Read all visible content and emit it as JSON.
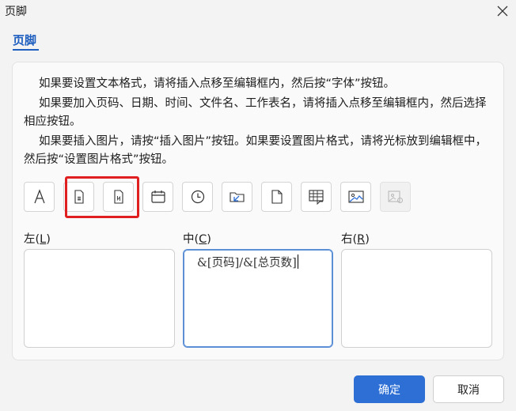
{
  "window": {
    "title": "页脚"
  },
  "tab": {
    "label": "页脚"
  },
  "instructions": [
    "如果要设置文本格式，请将插入点移至编辑框内，然后按“字体”按钮。",
    "如果要加入页码、日期、时间、文件名、工作表名，请将插入点移至编辑框内，然后选择相应按钮。",
    "如果要插入图片，请按“插入图片”按钮。如果要设置图片格式，请将光标放到编辑框中，然后按“设置图片格式”按钮。"
  ],
  "toolbar": {
    "buttons": [
      {
        "name": "font-button",
        "icon": "font-icon",
        "enabled": true
      },
      {
        "name": "insert-page-number-button",
        "icon": "page-number-icon",
        "enabled": true
      },
      {
        "name": "insert-total-pages-button",
        "icon": "total-pages-icon",
        "enabled": true
      },
      {
        "name": "insert-date-button",
        "icon": "calendar-icon",
        "enabled": true
      },
      {
        "name": "insert-time-button",
        "icon": "clock-icon",
        "enabled": true
      },
      {
        "name": "insert-file-path-button",
        "icon": "folder-path-icon",
        "enabled": true
      },
      {
        "name": "insert-file-name-button",
        "icon": "file-icon",
        "enabled": true
      },
      {
        "name": "insert-sheet-name-button",
        "icon": "sheet-icon",
        "enabled": true
      },
      {
        "name": "insert-picture-button",
        "icon": "picture-icon",
        "enabled": true
      },
      {
        "name": "format-picture-button",
        "icon": "format-picture-icon",
        "enabled": false
      }
    ],
    "highlight_color": "#e02020"
  },
  "sections": {
    "left": {
      "label": "左(",
      "key": "L",
      "label_end": ")",
      "value": ""
    },
    "center": {
      "label": "中(",
      "key": "C",
      "label_end": ")",
      "value": "&[页码]/&[总页数]"
    },
    "right": {
      "label": "右(",
      "key": "R",
      "label_end": ")",
      "value": ""
    }
  },
  "buttons": {
    "ok": "确定",
    "cancel": "取消"
  },
  "colors": {
    "accent": "#1f5fbf",
    "primary_button": "#2e6fd6",
    "active_border": "#5b8fd6"
  }
}
